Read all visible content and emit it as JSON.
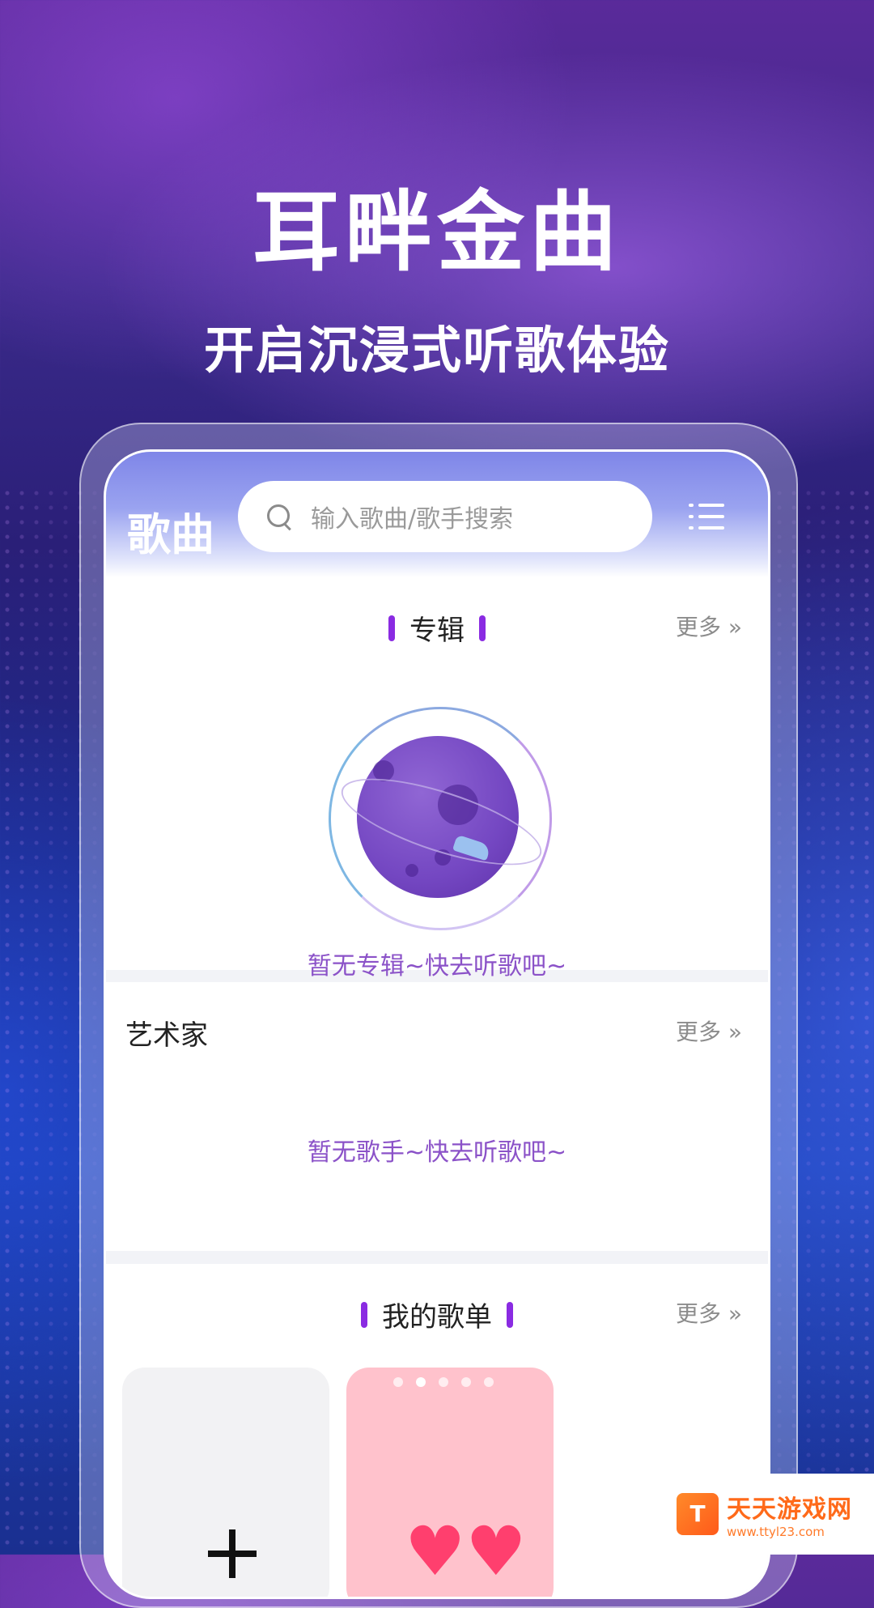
{
  "promo": {
    "headline": "耳畔金曲",
    "subline": "开启沉浸式听歌体验"
  },
  "header": {
    "title": "歌曲",
    "search_placeholder": "输入歌曲/歌手搜索",
    "menu_icon": "list-menu-icon"
  },
  "albums": {
    "title": "专辑",
    "more_label": "更多 »",
    "empty_text": "暂无专辑~快去听歌吧~",
    "illustration": "planet-illustration"
  },
  "artists": {
    "title": "艺术家",
    "more_label": "更多 »",
    "empty_text": "暂无歌手~快去听歌吧~"
  },
  "playlists": {
    "title": "我的歌单",
    "more_label": "更多 »",
    "cards": [
      {
        "icon": "plus-icon"
      },
      {
        "icon": "hearts-icon"
      }
    ]
  },
  "watermark": {
    "logo": "T",
    "name": "天天游戏网",
    "url": "www.ttyl23.com"
  },
  "colors": {
    "accent": "#8a2be2",
    "empty_text": "#8b52c8",
    "header_gradient_top": "#7f86e8",
    "watermark_orange": "#ff6a1a"
  }
}
